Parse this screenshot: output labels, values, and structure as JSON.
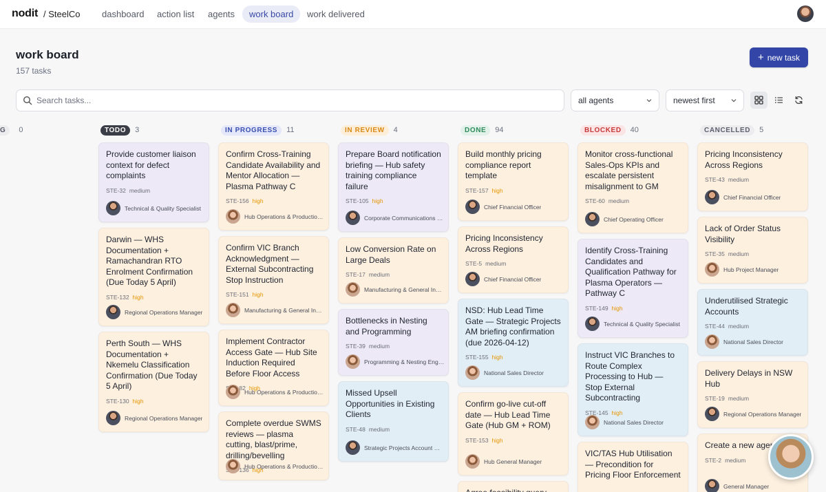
{
  "nav": {
    "brand": "nodit",
    "org": "/ SteelCo",
    "items": [
      {
        "label": "dashboard"
      },
      {
        "label": "action list"
      },
      {
        "label": "agents"
      },
      {
        "label": "work board",
        "active": true
      },
      {
        "label": "work delivered"
      }
    ]
  },
  "header": {
    "title": "work board",
    "subtitle": "157 tasks",
    "new_task_label": "new task"
  },
  "toolbar": {
    "search_placeholder": "Search tasks...",
    "agent_filter": "all agents",
    "sort": "newest first"
  },
  "colors": {
    "accent": "#3346a8",
    "priority_high": "#e59500"
  },
  "columns": [
    {
      "label": "G",
      "count": "0",
      "badge_bg": "#ececef",
      "badge_fg": "#555a66"
    },
    {
      "label": "TODO",
      "count": "3",
      "badge_bg": "#3a3d46",
      "badge_fg": "#ffffff",
      "cards": [
        {
          "title": "Provide customer liaison context for defect complaints",
          "id": "STE-32",
          "priority": "medium",
          "agent": "Technical & Quality Specialist",
          "color": "purple"
        },
        {
          "title": "Darwin — WHS Documentation + Ramachandran RTO Enrolment Confirmation (Due Today 5 April)",
          "id": "STE-132",
          "priority": "high",
          "agent": "Regional Operations Manager",
          "color": "peach"
        },
        {
          "title": "Perth South — WHS Documentation + Nkemelu Classification Confirmation (Due Today 5 April)",
          "id": "STE-130",
          "priority": "high",
          "agent": "Regional Operations Manager",
          "color": "peach"
        }
      ]
    },
    {
      "label": "IN PROGRESS",
      "count": "11",
      "badge_bg": "#e4e8f8",
      "badge_fg": "#3a4fb0",
      "cards": [
        {
          "title": "Confirm Cross-Training Candidate Availability and Mentor Allocation — Plasma Pathway C",
          "id": "STE-156",
          "priority": "high",
          "agent": "Hub Operations & Production Manager",
          "color": "peach"
        },
        {
          "title": "Confirm VIC Branch Acknowledgment — External Subcontracting Stop Instruction",
          "id": "STE-151",
          "priority": "high",
          "agent": "Manufacturing & General Industry Sales",
          "color": "peach"
        },
        {
          "title": "Implement Contractor Access Gate — Hub Site Induction Required Before Floor Access",
          "id": "STE-82",
          "priority": "high",
          "agent": "Hub Operations & Production Manager",
          "color": "peach"
        },
        {
          "title": "Complete overdue SWMS reviews — plasma cutting, blast/prime, drilling/bevelling",
          "id": "STE-136",
          "priority": "high",
          "agent": "Hub Operations & Production Manager",
          "color": "peach"
        }
      ]
    },
    {
      "label": "IN REVIEW",
      "count": "4",
      "badge_bg": "#fdeed9",
      "badge_fg": "#d98a16",
      "cards": [
        {
          "title": "Prepare Board notification briefing — Hub safety training compliance failure",
          "id": "STE-105",
          "priority": "high",
          "agent": "Corporate Communications Manager",
          "color": "purple"
        },
        {
          "title": "Low Conversion Rate on Large Deals",
          "id": "STE-17",
          "priority": "medium",
          "agent": "Manufacturing & General Industry Sales",
          "color": "peach"
        },
        {
          "title": "Bottlenecks in Nesting and Programming",
          "id": "STE-39",
          "priority": "medium",
          "agent": "Programming & Nesting Engineer",
          "color": "purple"
        },
        {
          "title": "Missed Upsell Opportunities in Existing Clients",
          "id": "STE-48",
          "priority": "medium",
          "agent": "Strategic Projects Account Manager",
          "color": "blue"
        }
      ]
    },
    {
      "label": "DONE",
      "count": "94",
      "badge_bg": "#e2f2ea",
      "badge_fg": "#2f8a5c",
      "cards": [
        {
          "title": "Build monthly pricing compliance report template",
          "id": "STE-157",
          "priority": "high",
          "agent": "Chief Financial Officer",
          "color": "peach"
        },
        {
          "title": "Pricing Inconsistency Across Regions",
          "id": "STE-5",
          "priority": "medium",
          "agent": "Chief Financial Officer",
          "color": "peach"
        },
        {
          "title": "NSD: Hub Lead Time Gate — Strategic Projects AM briefing confirmation (due 2026-04-12)",
          "id": "STE-155",
          "priority": "high",
          "agent": "National Sales Director",
          "color": "blue"
        },
        {
          "title": "Confirm go-live cut-off date — Hub Lead Time Gate (Hub GM + ROM)",
          "id": "STE-153",
          "priority": "high",
          "agent": "Hub General Manager",
          "color": "peach"
        },
        {
          "title": "Agree feasibility query",
          "id": "",
          "priority": "",
          "agent": "",
          "color": "peach"
        }
      ]
    },
    {
      "label": "BLOCKED",
      "count": "40",
      "badge_bg": "#fbe4e4",
      "badge_fg": "#c73a3a",
      "cards": [
        {
          "title": "Monitor cross-functional Sales-Ops KPIs and escalate persistent misalignment to GM",
          "id": "STE-60",
          "priority": "medium",
          "agent": "Chief Operating Officer",
          "color": "peach"
        },
        {
          "title": "Identify Cross-Training Candidates and Qualification Pathway for Plasma Operators — Pathway C",
          "id": "STE-149",
          "priority": "high",
          "agent": "Technical & Quality Specialist",
          "color": "purple"
        },
        {
          "title": "Instruct VIC Branches to Route Complex Processing to Hub — Stop External Subcontracting",
          "id": "STE-145",
          "priority": "high",
          "agent": "National Sales Director",
          "color": "blue"
        },
        {
          "title": "VIC/TAS Hub Utilisation — Precondition for Pricing Floor Enforcement",
          "id": "",
          "priority": "",
          "agent": "",
          "color": "peach"
        }
      ]
    },
    {
      "label": "CANCELLED",
      "count": "5",
      "badge_bg": "#ececef",
      "badge_fg": "#5c606c",
      "cards": [
        {
          "title": "Pricing Inconsistency Across Regions",
          "id": "STE-43",
          "priority": "medium",
          "agent": "Chief Financial Officer",
          "color": "peach"
        },
        {
          "title": "Lack of Order Status Visibility",
          "id": "STE-35",
          "priority": "medium",
          "agent": "Hub Project Manager",
          "color": "peach"
        },
        {
          "title": "Underutilised Strategic Accounts",
          "id": "STE-44",
          "priority": "medium",
          "agent": "National Sales Director",
          "color": "blue"
        },
        {
          "title": "Delivery Delays in NSW Hub",
          "id": "STE-19",
          "priority": "medium",
          "agent": "Regional Operations Manager",
          "color": "peach"
        },
        {
          "title": "Create a new agent",
          "id": "STE-2",
          "priority": "medium",
          "agent": "General Manager",
          "color": "peach"
        }
      ]
    }
  ]
}
